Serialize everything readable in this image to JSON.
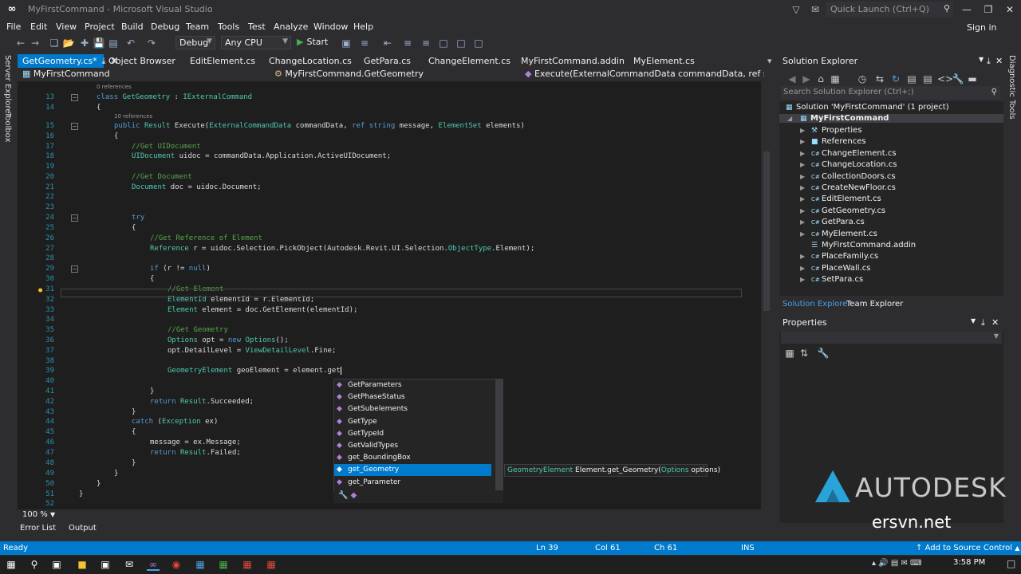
{
  "window": {
    "title": "MyFirstCommand - Microsoft Visual Studio",
    "quick_launch": "Quick Launch (Ctrl+Q)",
    "sign_in": "Sign in"
  },
  "menu": [
    "File",
    "Edit",
    "View",
    "Project",
    "Build",
    "Debug",
    "Team",
    "Tools",
    "Test",
    "Analyze",
    "Window",
    "Help"
  ],
  "toolbar": {
    "config": "Debug",
    "platform": "Any CPU",
    "start": "Start"
  },
  "side_tabs": [
    "Server Explorer",
    "Toolbox"
  ],
  "right_side_tabs": [
    "Diagnostic Tools"
  ],
  "tabs": [
    "GetGeometry.cs*",
    "Object Browser",
    "EditElement.cs",
    "ChangeLocation.cs",
    "GetPara.cs",
    "ChangeElement.cs",
    "MyFirstCommand.addin",
    "MyElement.cs"
  ],
  "navbar": {
    "project": "MyFirstCommand",
    "class": "MyFirstCommand.GetGeometry",
    "member": "Execute(ExternalCommandData commandData, ref string message,"
  },
  "code": {
    "lines": [
      "13",
      "14",
      "15",
      "16",
      "17",
      "18",
      "19",
      "20",
      "21",
      "22",
      "23",
      "24",
      "25",
      "26",
      "27",
      "28",
      "29",
      "30",
      "31",
      "32",
      "33",
      "34",
      "35",
      "36",
      "37",
      "38",
      "39",
      "40",
      "41",
      "42",
      "43",
      "44",
      "45",
      "46",
      "47",
      "48",
      "49",
      "50",
      "51",
      "52"
    ],
    "refs": [
      "0 references",
      "10 references"
    ],
    "c13a": "class ",
    "c13b": "GetGeometry",
    "c13c": " : ",
    "c13d": "IExternalCommand",
    "c14": "{",
    "c15a": "public ",
    "c15b": "Result ",
    "c15c": "Execute(",
    "c15d": "ExternalCommandData ",
    "c15e": "commandData, ",
    "c15f": "ref string ",
    "c15g": "message, ",
    "c15h": "ElementSet ",
    "c15i": "elements)",
    "c16": "{",
    "c17": "//Get UIDocument",
    "c18a": "UIDocument ",
    "c18b": "uidoc = commandData.Application.ActiveUIDocument;",
    "c20": "//Get Document",
    "c21a": "Document ",
    "c21b": "doc = uidoc.Document;",
    "c24": "try",
    "c25": "{",
    "c26": "//Get Reference of Element",
    "c27a": "Reference ",
    "c27b": "r = uidoc.Selection.PickObject(Autodesk.Revit.UI.Selection.",
    "c27c": "ObjectType",
    "c27d": ".Element);",
    "c29a": "if ",
    "c29b": "(r != ",
    "c29c": "null",
    "c29d": ")",
    "c30": "{",
    "c31": "//Get Element",
    "c32a": "ElementId ",
    "c32b": "elementId = r.ElementId;",
    "c33a": "Element ",
    "c33b": "element = doc.GetElement(elementId);",
    "c35": "//Get Geometry",
    "c36a": "Options ",
    "c36b": "opt = ",
    "c36c": "new ",
    "c36d": "Options",
    "c36e": "();",
    "c37a": "opt.DetailLevel = ",
    "c37b": "ViewDetailLevel",
    "c37c": ".Fine;",
    "c39a": "GeometryElement ",
    "c39b": "geoElement = element.get",
    "c41": "}",
    "c42a": "return ",
    "c42b": "Result",
    "c42c": ".Succeeded;",
    "c43": "}",
    "c44a": "catch ",
    "c44b": "(",
    "c44c": "Exception ",
    "c44d": "ex)",
    "c45": "{",
    "c46": "message = ex.Message;",
    "c47a": "return ",
    "c47b": "Result",
    "c47c": ".Failed;",
    "c48": "}",
    "c49": "}",
    "c50": "}",
    "c51": "}"
  },
  "zoom": "100 %",
  "completion": {
    "items": [
      "GetParameters",
      "GetPhaseStatus",
      "GetSubelements",
      "GetType",
      "GetTypeId",
      "GetValidTypes",
      "get_BoundingBox",
      "get_Geometry",
      "get_Parameter"
    ],
    "selected": "get_Geometry"
  },
  "tooltip": {
    "type": "GeometryElement",
    "sig": " Element.get_Geometry(",
    "param_type": "Options",
    "param": " options)"
  },
  "solution_explorer": {
    "title": "Solution Explorer",
    "search": "Search Solution Explorer (Ctrl+;)",
    "solution": "Solution 'MyFirstCommand' (1 project)",
    "project": "MyFirstCommand",
    "items": [
      "Properties",
      "References",
      "ChangeElement.cs",
      "ChangeLocation.cs",
      "CollectionDoors.cs",
      "CreateNewFloor.cs",
      "EditElement.cs",
      "GetGeometry.cs",
      "GetPara.cs",
      "MyElement.cs",
      "MyFirstCommand.addin",
      "PlaceFamily.cs",
      "PlaceWall.cs",
      "SetPara.cs"
    ],
    "tabs": [
      "Solution Explorer",
      "Team Explorer"
    ]
  },
  "properties": {
    "title": "Properties"
  },
  "bottom_tabs": [
    "Error List",
    "Output"
  ],
  "status": {
    "ready": "Ready",
    "ln": "Ln 39",
    "col": "Col 61",
    "ch": "Ch 61",
    "ins": "INS",
    "source_control": "Add to Source Control"
  },
  "clock": "3:58 PM",
  "watermarks": {
    "autodesk": "AUTODESK",
    "site": "ersvn.net"
  },
  "colors": {
    "accent": "#007acc",
    "editor_bg": "#1e1e1e",
    "keyword": "#569cd6",
    "type": "#4ec9b0",
    "comment": "#57a64a"
  }
}
